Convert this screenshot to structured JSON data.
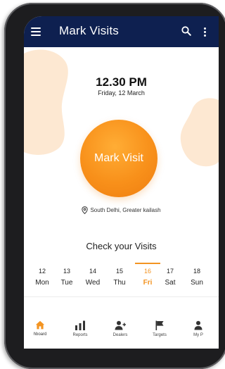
{
  "app": {
    "title": "Mark Visits"
  },
  "clock": {
    "time": "12.30 PM",
    "date": "Friday, 12 March"
  },
  "mark_button": {
    "label": "Mark Visit"
  },
  "location": {
    "text": "South Delhi, Greater kailash"
  },
  "visits": {
    "title": "Check your Visits",
    "days": [
      {
        "num": "12",
        "day": "Mon"
      },
      {
        "num": "13",
        "day": "Tue"
      },
      {
        "num": "14",
        "day": "Wed"
      },
      {
        "num": "15",
        "day": "Thu"
      },
      {
        "num": "16",
        "day": "Fri"
      },
      {
        "num": "17",
        "day": "Sat"
      },
      {
        "num": "18",
        "day": "Sun"
      }
    ],
    "selected_day": "Fri"
  },
  "nav": {
    "items": [
      {
        "label": "hboard",
        "icon": "home-icon"
      },
      {
        "label": "Reports",
        "icon": "bar-chart-icon"
      },
      {
        "label": "Dealers",
        "icon": "add-user-icon"
      },
      {
        "label": "Targets",
        "icon": "flag-icon"
      },
      {
        "label": "My P",
        "icon": "profile-icon"
      }
    ],
    "active": "hboard"
  },
  "colors": {
    "appbar": "#0e2050",
    "accent": "#f39422",
    "button": "#f8901a",
    "blob": "#fde8d2"
  }
}
